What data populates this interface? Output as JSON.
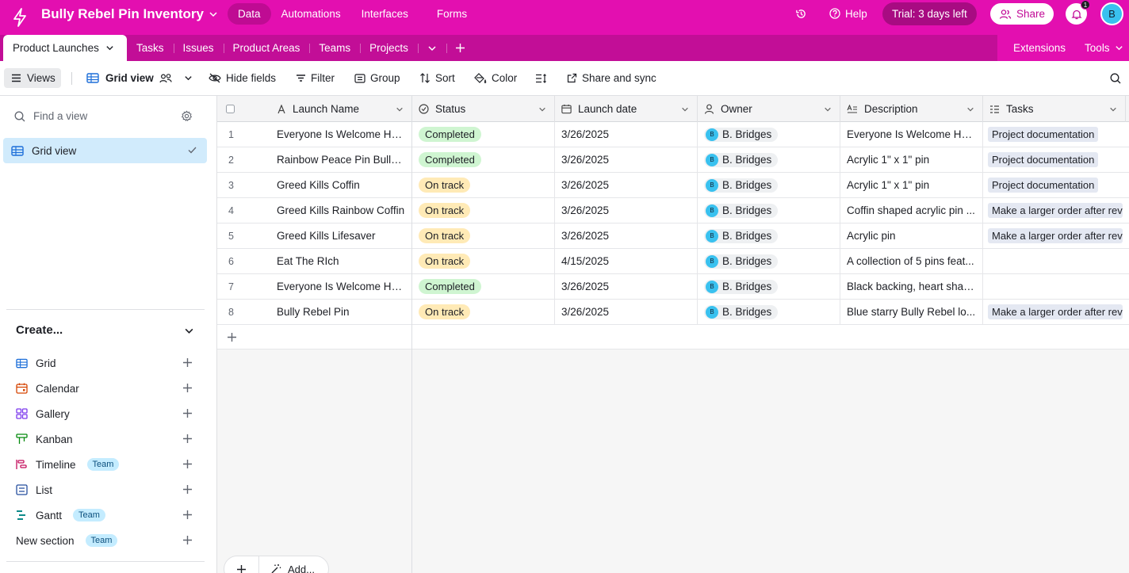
{
  "app": {
    "base_name": "Bully Rebel Pin Inventory",
    "nav": [
      "Data",
      "Automations",
      "Interfaces",
      "Forms"
    ],
    "help_label": "Help",
    "trial_label": "Trial: 3 days left",
    "share_label": "Share",
    "notification_count": "1",
    "user_initial": "B",
    "brand_color": "#e30fb0"
  },
  "tables": {
    "active": "Product Launches",
    "others": [
      "Tasks",
      "Issues",
      "Product Areas",
      "Teams",
      "Projects"
    ],
    "extensions_label": "Extensions",
    "tools_label": "Tools"
  },
  "toolbar": {
    "views_label": "Views",
    "view_name": "Grid view",
    "hide_fields": "Hide fields",
    "filter": "Filter",
    "group": "Group",
    "sort": "Sort",
    "color": "Color",
    "share_sync": "Share and sync"
  },
  "sidebar": {
    "find_placeholder": "Find a view",
    "views": [
      {
        "label": "Grid view",
        "selected": true
      }
    ],
    "create_label": "Create...",
    "create_items": [
      {
        "label": "Grid",
        "badge": ""
      },
      {
        "label": "Calendar",
        "badge": ""
      },
      {
        "label": "Gallery",
        "badge": ""
      },
      {
        "label": "Kanban",
        "badge": ""
      },
      {
        "label": "Timeline",
        "badge": "Team"
      },
      {
        "label": "List",
        "badge": ""
      },
      {
        "label": "Gantt",
        "badge": "Team"
      },
      {
        "label": "New section",
        "badge": "Team"
      }
    ]
  },
  "grid": {
    "columns": [
      "Launch Name",
      "Status",
      "Launch date",
      "Owner",
      "Description",
      "Tasks"
    ],
    "rows": [
      {
        "num": "1",
        "name": "Everyone Is Welcome Her...",
        "status": "Completed",
        "date": "3/26/2025",
        "owner": "B. Bridges",
        "description": "Everyone Is Welcome Her...",
        "task": "Project documentation"
      },
      {
        "num": "2",
        "name": "Rainbow Peace Pin Bully ...",
        "status": "Completed",
        "date": "3/26/2025",
        "owner": "B. Bridges",
        "description": "Acrylic 1\" x 1\" pin",
        "task": "Project documentation"
      },
      {
        "num": "3",
        "name": "Greed Kills Coffin",
        "status": "On track",
        "date": "3/26/2025",
        "owner": "B. Bridges",
        "description": "Acrylic 1\" x 1\" pin",
        "task": "Project documentation"
      },
      {
        "num": "4",
        "name": "Greed Kills Rainbow Coffin",
        "status": "On track",
        "date": "3/26/2025",
        "owner": "B. Bridges",
        "description": "Coffin shaped acrylic pin ...",
        "task": "Make a larger order after rev"
      },
      {
        "num": "5",
        "name": "Greed Kills Lifesaver",
        "status": "On track",
        "date": "3/26/2025",
        "owner": "B. Bridges",
        "description": "Acrylic pin",
        "task": "Make a larger order after rev"
      },
      {
        "num": "6",
        "name": "Eat The RIch",
        "status": "On track",
        "date": "4/15/2025",
        "owner": "B. Bridges",
        "description": "A collection of 5 pins feat...",
        "task": ""
      },
      {
        "num": "7",
        "name": "Everyone Is Welcome Her...",
        "status": "Completed",
        "date": "3/26/2025",
        "owner": "B. Bridges",
        "description": "Black backing, heart shap...",
        "task": ""
      },
      {
        "num": "8",
        "name": "Bully Rebel Pin",
        "status": "On track",
        "date": "3/26/2025",
        "owner": "B. Bridges",
        "description": "Blue starry Bully Rebel lo...",
        "task": "Make a larger order after rev"
      }
    ],
    "status_colors": {
      "Completed": "#cff5d1",
      "On track": "#ffeab6"
    },
    "owner_initial": "B",
    "add_label": "Add..."
  }
}
